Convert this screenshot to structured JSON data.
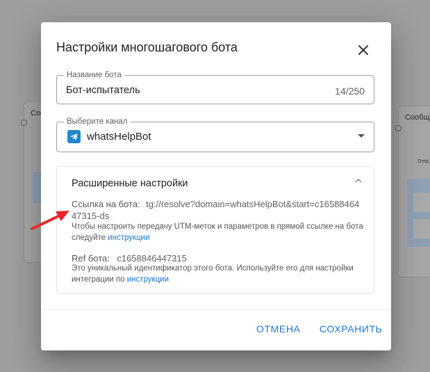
{
  "background": {
    "node_left_title": "Соо",
    "node_right_title": "Сообщ",
    "node_right_small": "Отпр"
  },
  "dialog": {
    "title": "Настройки многошагового бота",
    "close_icon": "close-icon",
    "bot_name": {
      "label": "Название бота",
      "value": "Бот-испытатель",
      "counter": "14/250"
    },
    "channel": {
      "label": "Выберите канал",
      "value": "whatsHelpBot",
      "icon": "telegram-icon"
    },
    "advanced": {
      "title": "Расширенные настройки",
      "link_label": "Ссылка на бота:",
      "link_value": "tg://resolve?domain=whatsHelpBot&start=c1658846447315-ds",
      "link_hint_text": "Чтобы настроить передачу UTM-меток и параметров в прямой ссылке на бота следуйте",
      "link_hint_link": "инструкции",
      "ref_label": "Ref бота:",
      "ref_value": "c1658846447315",
      "ref_hint_text": "Это уникальный идентификатор этого бота. Используйте его для настройки интеграции по",
      "ref_hint_link": "инструкции"
    },
    "actions": {
      "cancel": "Отмена",
      "save": "Сохранить"
    }
  },
  "colors": {
    "accent": "#1976d2",
    "telegram": "#1e88d0",
    "annotation_arrow": "#e8262b"
  }
}
